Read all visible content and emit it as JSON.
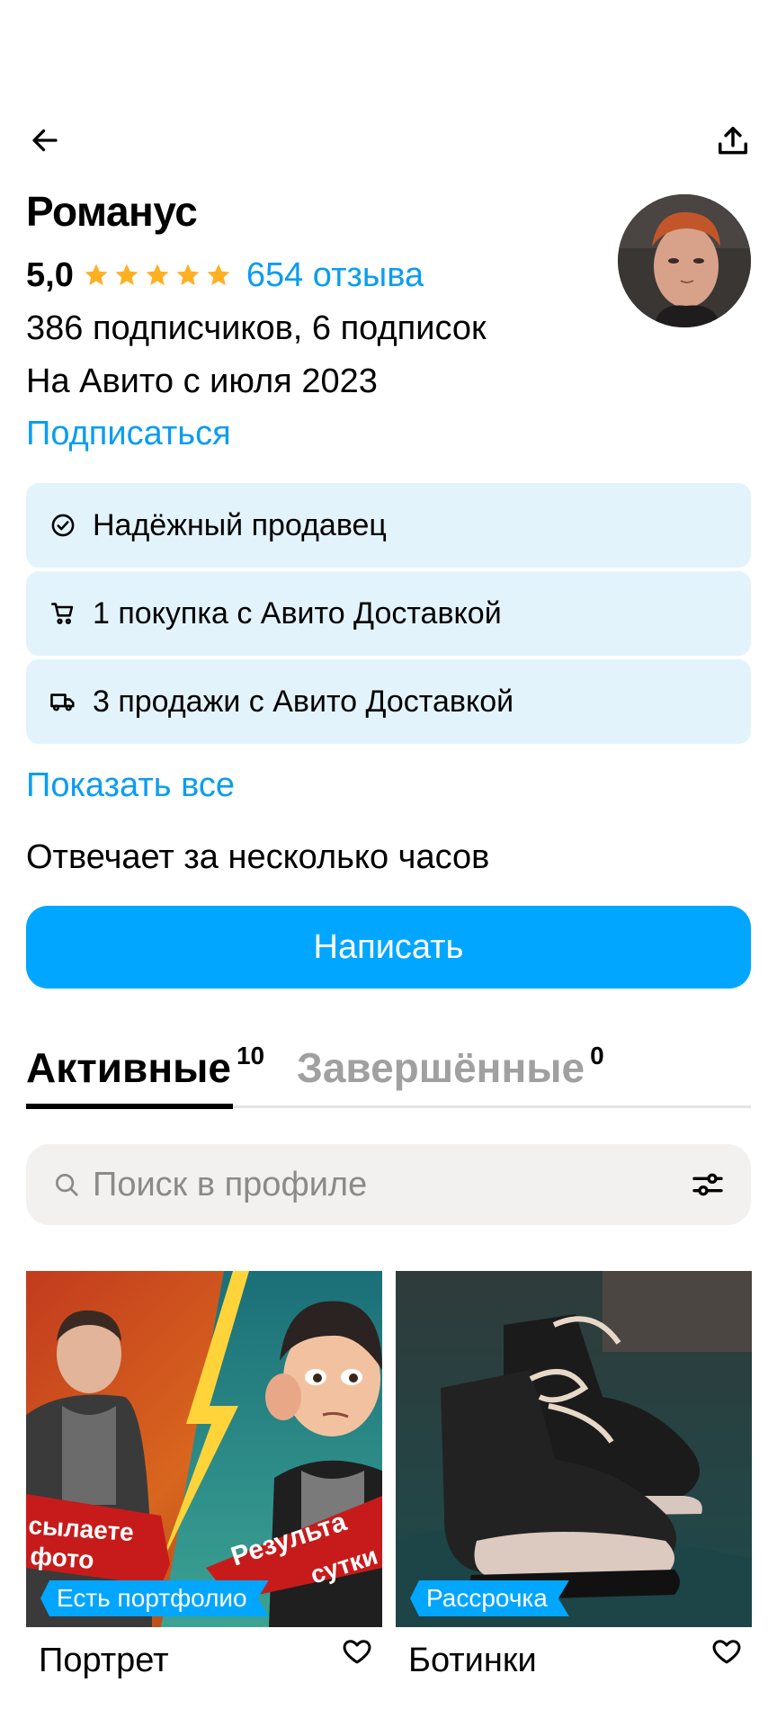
{
  "header": {
    "back_icon": "arrow-left-icon",
    "share_icon": "share-upload-icon"
  },
  "profile": {
    "name": "Романус",
    "rating": "5,0",
    "stars": 5,
    "reviews": "654 отзыва",
    "subscribers": "386 подписчиков, 6 подписок",
    "since": "На Авито с июля 2023",
    "subscribe_label": "Подписаться"
  },
  "badges": [
    {
      "icon": "check-circle-icon",
      "label": "Надёжный продавец"
    },
    {
      "icon": "cart-icon",
      "label": "1 покупка с Авито Доставкой"
    },
    {
      "icon": "truck-icon",
      "label": "3 продажи с Авито Доставкой"
    }
  ],
  "show_all_label": "Показать все",
  "response_time": "Отвечает за несколько часов",
  "write_button": "Написать",
  "tabs": [
    {
      "label": "Активные",
      "count": "10",
      "active": true
    },
    {
      "label": "Завершённые",
      "count": "0",
      "active": false
    }
  ],
  "search": {
    "placeholder": "Поиск в профиле"
  },
  "listings": [
    {
      "title": "Портрет",
      "tag": "Есть портфолио",
      "overlay_left": "сылаете",
      "overlay_left2": "фото",
      "overlay_right": "Результа",
      "overlay_right2": "сутки"
    },
    {
      "title": "Ботинки",
      "tag": "Рассрочка"
    }
  ],
  "colors": {
    "accent": "#00a6ff",
    "link": "#0a9df0",
    "badge_bg": "#e3f3fc",
    "star": "#ffb021"
  }
}
